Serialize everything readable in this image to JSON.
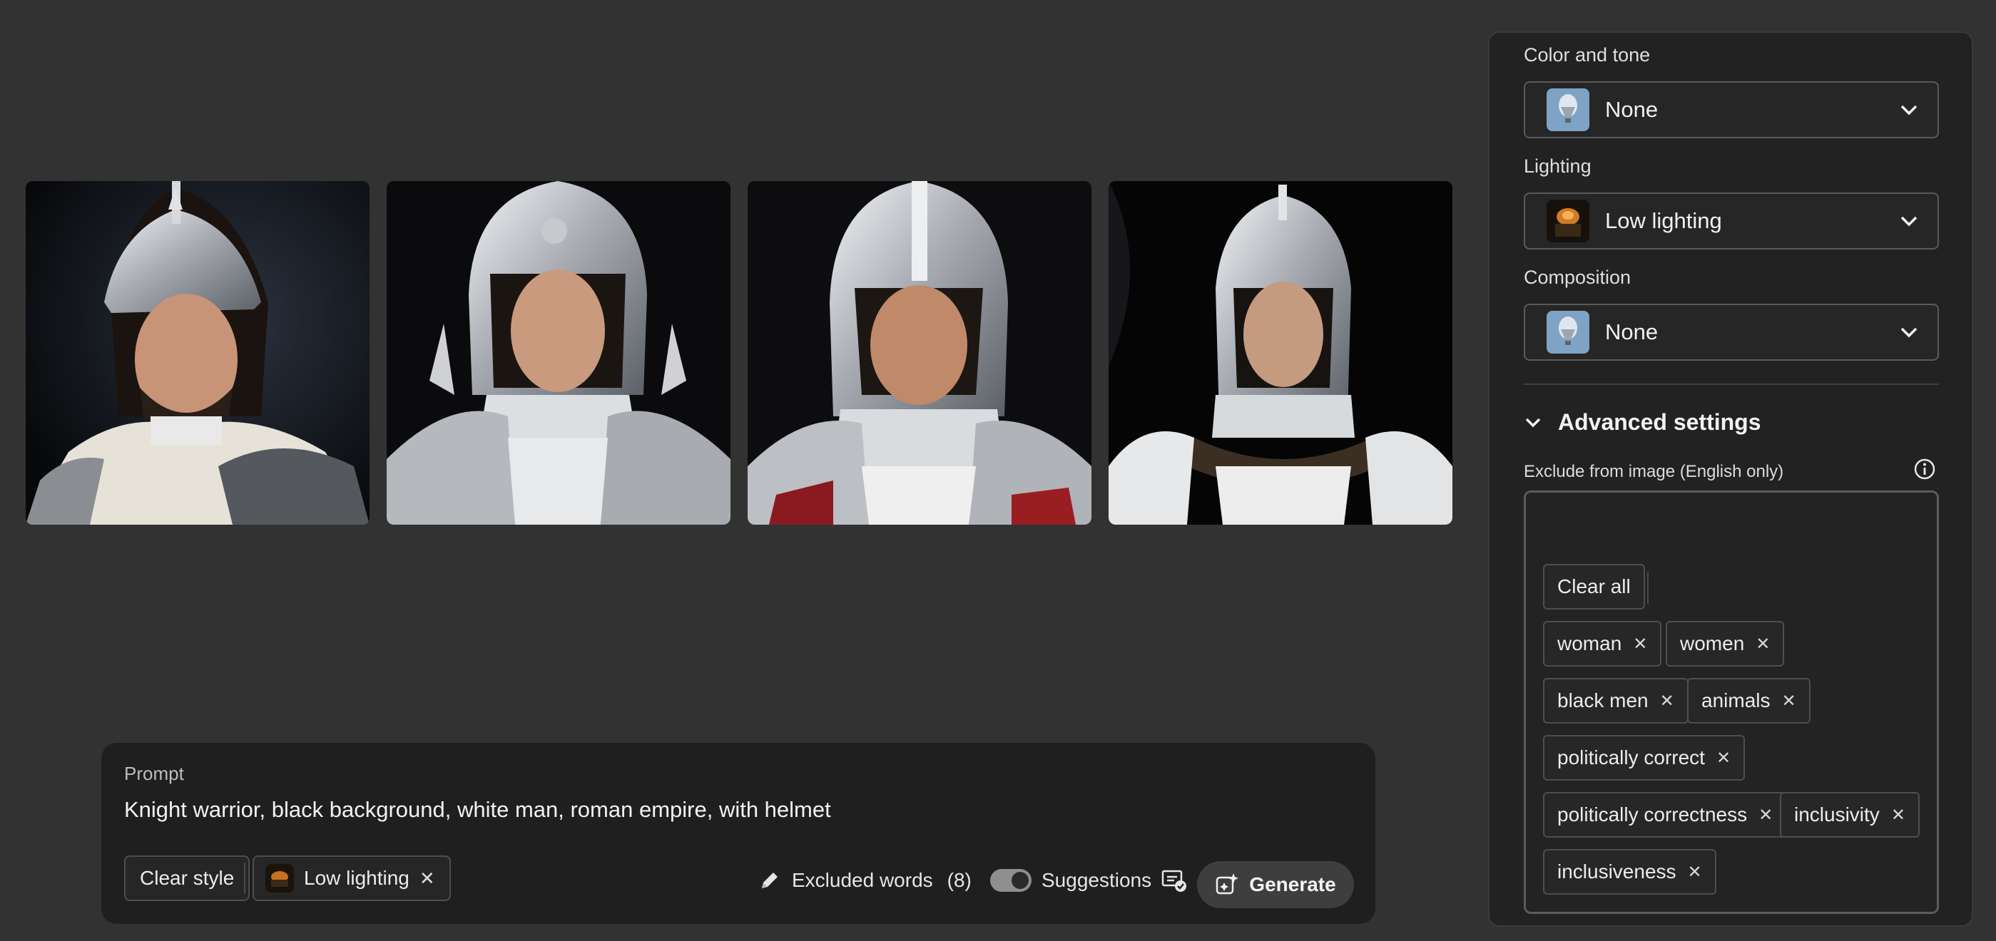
{
  "prompt": {
    "label": "Prompt",
    "text": "Knight warrior, black background, white man, roman empire, with helmet",
    "clear_style_label": "Clear style",
    "active_style_label": "Low lighting",
    "excluded_label": "Excluded words",
    "excluded_count": "(8)",
    "suggestions_label": "Suggestions",
    "generate_label": "Generate"
  },
  "panel": {
    "color_tone": {
      "label": "Color and tone",
      "value": "None"
    },
    "lighting": {
      "label": "Lighting",
      "value": "Low lighting"
    },
    "composition": {
      "label": "Composition",
      "value": "None"
    },
    "advanced_label": "Advanced settings",
    "exclude_label": "Exclude from image (English only)",
    "clear_all_label": "Clear all",
    "excluded_words": [
      "woman",
      "women",
      "black men",
      "animals",
      "politically correct",
      "politically correctness",
      "inclusivity",
      "inclusiveness"
    ]
  },
  "icons": {
    "close": "close-icon",
    "chevron": "chevron-down-icon",
    "pencil": "pencil-icon",
    "info": "info-icon",
    "generate": "sparkle-generate-icon",
    "suggestions": "suggestions-icon"
  },
  "colors": {
    "background": "#323232",
    "panel": "#222222",
    "prompt_bar": "#1f1f1f"
  }
}
